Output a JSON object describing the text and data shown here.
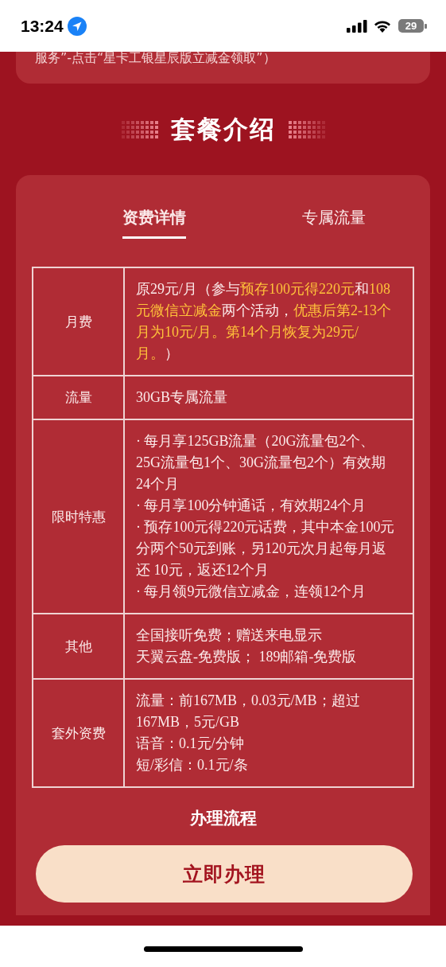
{
  "status_bar": {
    "time": "13:24",
    "battery": "29"
  },
  "notice": {
    "text": "服务”-点击“星卡工银星辰版立减金领取”）"
  },
  "section_title": "套餐介绍",
  "tabs": [
    {
      "label": "资费详情",
      "selected": true
    },
    {
      "label": "专属流量",
      "selected": false
    }
  ],
  "table": {
    "rows": [
      {
        "label": "月费",
        "paragraphs": [
          [
            {
              "text": "原29元/月（参与",
              "highlight": false
            },
            {
              "text": "预存100元得220元",
              "highlight": true
            },
            {
              "text": "和",
              "highlight": false
            },
            {
              "text": "108元微信立减金",
              "highlight": true
            },
            {
              "text": "两个活动，",
              "highlight": false
            },
            {
              "text": "优惠后第2-13个月为10元/月。第14个月恢复为29元/月。",
              "highlight": true
            },
            {
              "text": "）",
              "highlight": false
            }
          ]
        ]
      },
      {
        "label": "流量",
        "paragraphs": [
          [
            {
              "text": "30GB专属流量",
              "highlight": false
            }
          ]
        ]
      },
      {
        "label": "限时特惠",
        "paragraphs": [
          [
            {
              "text": "· 每月享125GB流量（20G流量包2个、25G流量包1个、30G流量包2个）有效期24个月",
              "highlight": false
            }
          ],
          [
            {
              "text": "· 每月享100分钟通话，有效期24个月",
              "highlight": false
            }
          ],
          [
            {
              "text": "· 预存100元得220元话费，其中本金100元分两个50元到账，另120元次月起每月返还 10元，返还12个月",
              "highlight": false
            }
          ],
          [
            {
              "text": "· 每月领9元微信立减金，连领12个月",
              "highlight": false
            }
          ]
        ]
      },
      {
        "label": "其他",
        "paragraphs": [
          [
            {
              "text": "全国接听免费；赠送来电显示",
              "highlight": false
            }
          ],
          [
            {
              "text": "天翼云盘-免费版； 189邮箱-免费版",
              "highlight": false
            }
          ]
        ]
      },
      {
        "label": "套外资费",
        "paragraphs": [
          [
            {
              "text": "流量：前167MB，0.03元/MB；超过167MB，5元/GB",
              "highlight": false
            }
          ],
          [
            {
              "text": "语音：0.1元/分钟",
              "highlight": false
            }
          ],
          [
            {
              "text": "短/彩信：0.1元/条",
              "highlight": false
            }
          ]
        ]
      }
    ]
  },
  "process_title": "办理流程",
  "apply_button": "立即办理"
}
